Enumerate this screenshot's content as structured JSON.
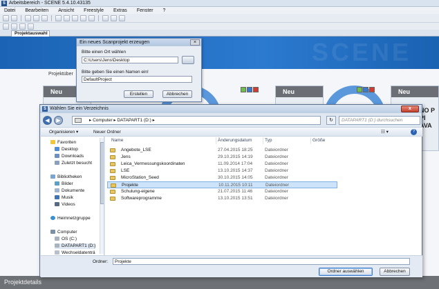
{
  "app": {
    "title": "Arbeitsbereich - SCENE 5.4.10.43135",
    "logo": "S",
    "menu": [
      "Datei",
      "Bearbeiten",
      "Ansicht",
      "Freestyle",
      "Extras",
      "Fenster",
      "?"
    ],
    "tab": "Projektauswahl",
    "projektuebersicht": "Projektüber",
    "card_label": "Neu",
    "side_text": "NO P PI AVA",
    "footer": "Projektdetails"
  },
  "create_dialog": {
    "title": "Ein neues Scanprojekt erzeugen",
    "close": "×",
    "location_label": "Bitte einen Ort wählen",
    "location_value": "C:\\Users\\Jens\\Desktop",
    "name_label": "Bitte geben Sie einen Namen ein!",
    "name_value": "DefaultProject",
    "create_button": "Erstellen",
    "cancel_button": "Abbrechen"
  },
  "folder_dialog": {
    "title": "Wählen Sie ein Verzeichnis",
    "close": "x",
    "breadcrumb": "▸ Computer ▸ DATAPART1 (D:) ▸",
    "search_placeholder": "DATAPART1 (D:) durchsuchen",
    "organize": "Organisieren ▾",
    "new_folder": "Neuer Ordner",
    "help": "?",
    "nav": [
      {
        "label": "Favoriten",
        "icon": "star-icon"
      },
      {
        "label": "Desktop",
        "icon": "desktop-icon"
      },
      {
        "label": "Downloads",
        "icon": "downloads-icon"
      },
      {
        "label": "Zuletzt besucht",
        "icon": "recent-icon"
      },
      {
        "label": "Bibliotheken",
        "icon": "library-icon"
      },
      {
        "label": "Bilder",
        "icon": "pictures-icon"
      },
      {
        "label": "Dokumente",
        "icon": "documents-icon"
      },
      {
        "label": "Musik",
        "icon": "music-icon"
      },
      {
        "label": "Videos",
        "icon": "videos-icon"
      },
      {
        "label": "Heimnetzgruppe",
        "icon": "homegroup-icon"
      },
      {
        "label": "Computer",
        "icon": "computer-icon"
      },
      {
        "label": "OS (C:)",
        "icon": "drive-icon"
      },
      {
        "label": "DATAPART1 (D:)",
        "icon": "drive-icon"
      },
      {
        "label": "Wechseldatenträ",
        "icon": "removable-drive-icon"
      }
    ],
    "columns": {
      "name": "Name",
      "date": "Änderungsdatum",
      "type": "Typ",
      "size": "Größe"
    },
    "rows": [
      {
        "name": "Angebote_LSE",
        "date": "27.04.2015 18:25",
        "type": "Dateiordner"
      },
      {
        "name": "Jens",
        "date": "29.10.2015 14:19",
        "type": "Dateiordner"
      },
      {
        "name": "Leica_Vermessungskoordinaten",
        "date": "11.09.2014 17:04",
        "type": "Dateiordner"
      },
      {
        "name": "LSE",
        "date": "13.10.2015 14:37",
        "type": "Dateiordner"
      },
      {
        "name": "MicroStation_Seed",
        "date": "30.10.2015 14:05",
        "type": "Dateiordner"
      },
      {
        "name": "Projekte",
        "date": "10.11.2015 10:11",
        "type": "Dateiordner",
        "selected": true
      },
      {
        "name": "Schulung-eigene",
        "date": "21.07.2015 11:46",
        "type": "Dateiordner"
      },
      {
        "name": "Softwareprogramme",
        "date": "13.10.2015 13:51",
        "type": "Dateiordner"
      }
    ],
    "folder_label": "Ordner:",
    "folder_value": "Projekte",
    "select_button": "Ordner auswählen",
    "cancel_button": "Abbrechen"
  },
  "colors": {
    "banner": "#1b63b4",
    "selection": "#cde3f9",
    "close_red": "#c4412c"
  }
}
